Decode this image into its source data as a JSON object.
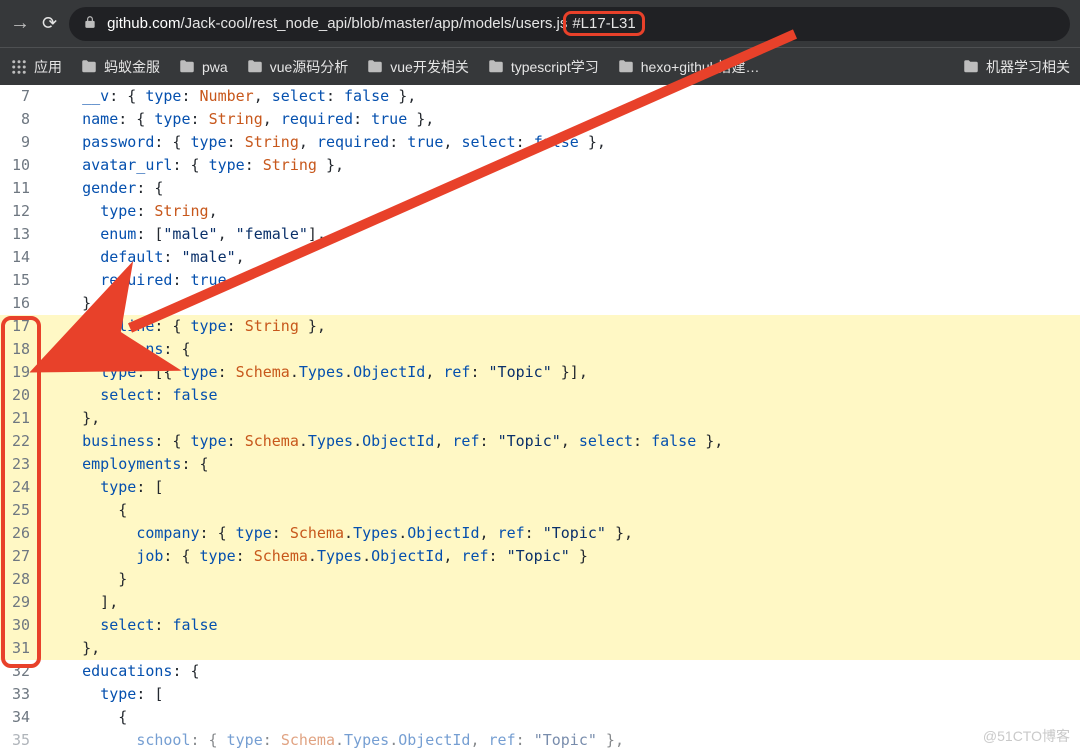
{
  "url": {
    "host": "github.com",
    "path": "/Jack-cool/rest_node_api/blob/master/app/models/users.js",
    "fragment": "#L17-L31"
  },
  "bookmarks": {
    "b0": "应用",
    "b1": "蚂蚁金服",
    "b2": "pwa",
    "b3": "vue源码分析",
    "b4": "vue开发相关",
    "b5": "typescript学习",
    "b6": "hexo+github搭建…",
    "b7": "机器学习相关"
  },
  "code": {
    "l7": "    __v: { type: Number, select: false },",
    "l8": "    name: { type: String, required: true },",
    "l9": "    password: { type: String, required: true, select: false },",
    "l10": "    avatar_url: { type: String },",
    "l11": "    gender: {",
    "l12": "      type: String,",
    "l13": "      enum: [\"male\", \"female\"],",
    "l14": "      default: \"male\",",
    "l15": "      required: true",
    "l16": "    },",
    "l17": "    headline: { type: String },",
    "l18": "    locations: {",
    "l19": "      type: [{ type: Schema.Types.ObjectId, ref: \"Topic\" }],",
    "l20": "      select: false",
    "l21": "    },",
    "l22": "    business: { type: Schema.Types.ObjectId, ref: \"Topic\", select: false },",
    "l23": "    employments: {",
    "l24": "      type: [",
    "l25": "        {",
    "l26": "          company: { type: Schema.Types.ObjectId, ref: \"Topic\" },",
    "l27": "          job: { type: Schema.Types.ObjectId, ref: \"Topic\" }",
    "l28": "        }",
    "l29": "      ],",
    "l30": "      select: false",
    "l31": "    },",
    "l32": "    educations: {",
    "l33": "      type: [",
    "l34": "        {",
    "l35": "          school: { type: Schema.Types.ObjectId, ref: \"Topic\" },"
  },
  "line_numbers": {
    "n7": "7",
    "n8": "8",
    "n9": "9",
    "n10": "10",
    "n11": "11",
    "n12": "12",
    "n13": "13",
    "n14": "14",
    "n15": "15",
    "n16": "16",
    "n17": "17",
    "n18": "18",
    "n19": "19",
    "n20": "20",
    "n21": "21",
    "n22": "22",
    "n23": "23",
    "n24": "24",
    "n25": "25",
    "n26": "26",
    "n27": "27",
    "n28": "28",
    "n29": "29",
    "n30": "30",
    "n31": "31",
    "n32": "32",
    "n33": "33",
    "n34": "34",
    "n35": "35"
  },
  "watermark": "@51CTO博客"
}
